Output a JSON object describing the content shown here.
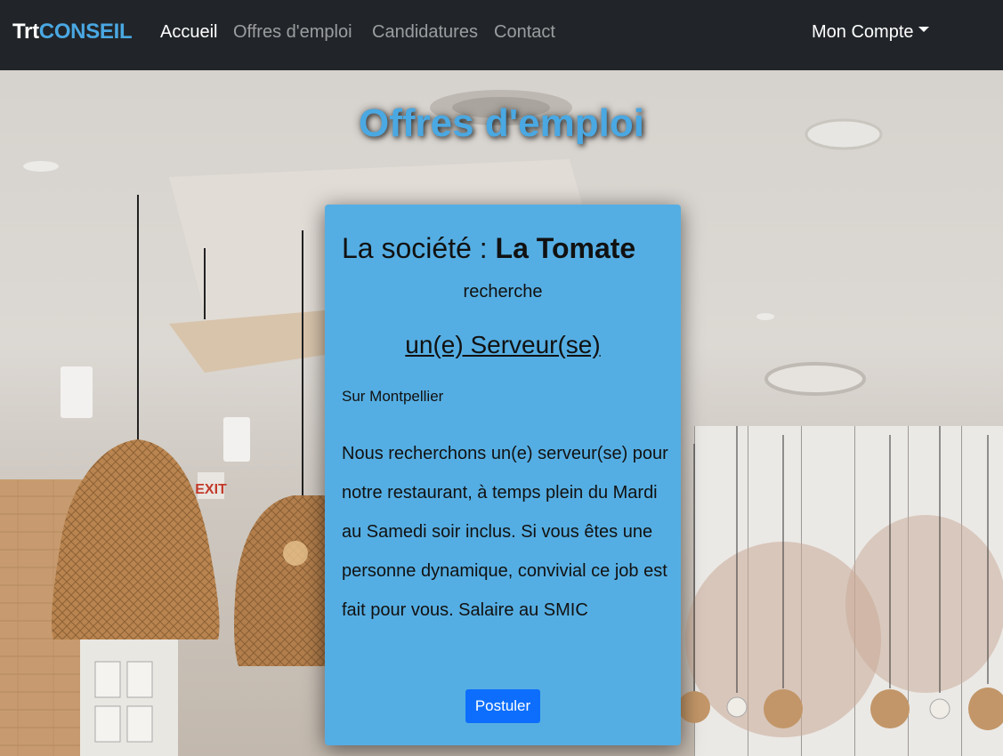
{
  "nav": {
    "brand_part1": "Trt",
    "brand_part2": "CONSEIL",
    "links": [
      "Accueil",
      "Offres d'emploi",
      "Candidatures",
      "Contact"
    ],
    "account": "Mon Compte",
    "brand_color": "#4aa8e2"
  },
  "page": {
    "title": "Offres d'emploi"
  },
  "offer": {
    "company_prefix": "La société : ",
    "company_name": "La Tomate",
    "search_text": "recherche",
    "position": "un(e) Serveur(se)",
    "location": "Sur Montpellier",
    "description": "Nous recherchons un(e) serveur(se) pour notre restaurant, à temps plein du Mardi au Samedi soir inclus. Si vous êtes une personne dynamique, convivial ce job est fait pour vous. Salaire au SMIC",
    "apply_label": "Postuler",
    "card_color": "#55aee3",
    "button_color": "#0d6efd"
  },
  "icons": {
    "account_caret": "caret-down-icon"
  }
}
